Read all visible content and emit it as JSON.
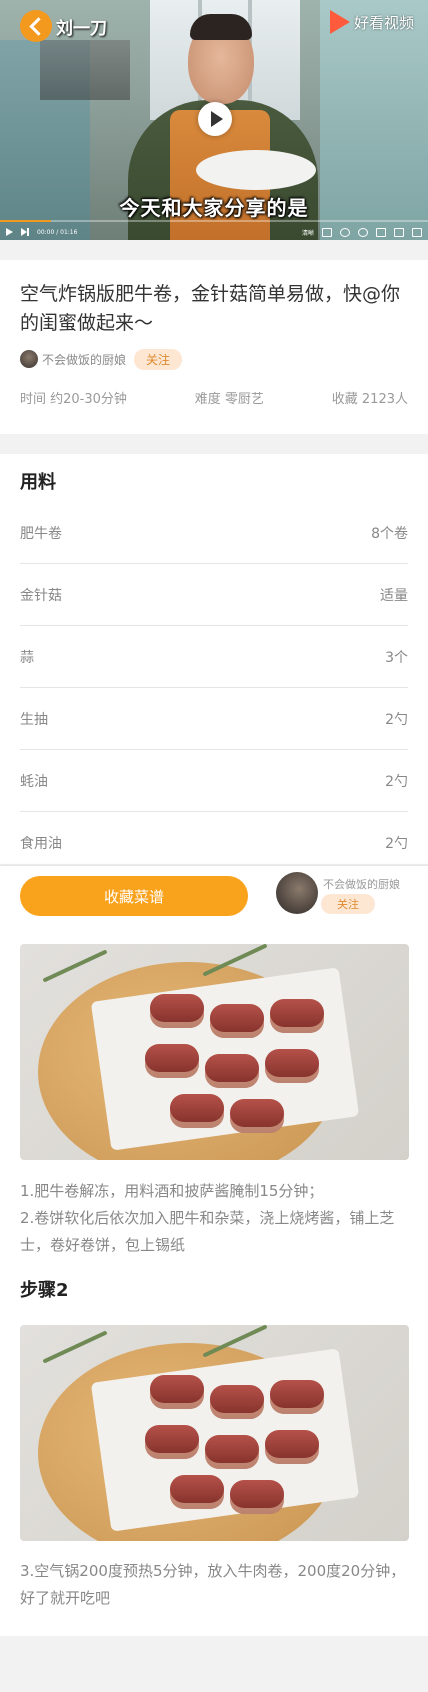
{
  "video": {
    "channel": "刘一刀",
    "brand": "好看视频",
    "subtitle": "今天和大家分享的是",
    "time": "00:00 / 01:16",
    "progress": 0.12,
    "control_label": "清晰"
  },
  "recipe": {
    "title": "空气炸锅版肥牛卷，金针菇简单易做，快@你的闺蜜做起来～",
    "author": "不会做饭的厨娘",
    "follow": "关注",
    "meta": {
      "time": "时间 约20-30分钟",
      "difficulty": "难度 零厨艺",
      "favorites": "收藏 2123人"
    }
  },
  "ingredients": {
    "title": "用料",
    "items": [
      {
        "name": "肥牛卷",
        "amount": "8个卷"
      },
      {
        "name": "金针菇",
        "amount": "适量"
      },
      {
        "name": "蒜",
        "amount": "3个"
      },
      {
        "name": "生抽",
        "amount": "2勺"
      },
      {
        "name": "蚝油",
        "amount": "2勺"
      },
      {
        "name": "食用油",
        "amount": "2勺"
      }
    ]
  },
  "action_bar": {
    "collect": "收藏菜谱",
    "author": "不会做饭的厨娘",
    "follow": "关注"
  },
  "steps": {
    "step1_text": "1.肥牛卷解冻，用料酒和披萨酱腌制15分钟；\n2.卷饼软化后依次加入肥牛和杂菜，浇上烧烤酱，铺上芝士，卷好卷饼，包上锡纸",
    "step2_title": "步骤2",
    "step2_text": "3.空气锅200度预热5分钟，放入牛肉卷，200度20分钟，好了就开吃吧"
  },
  "colors": {
    "accent": "#f9a21c",
    "follow_bg": "#fde7d3",
    "follow_text": "#e08a2e"
  }
}
